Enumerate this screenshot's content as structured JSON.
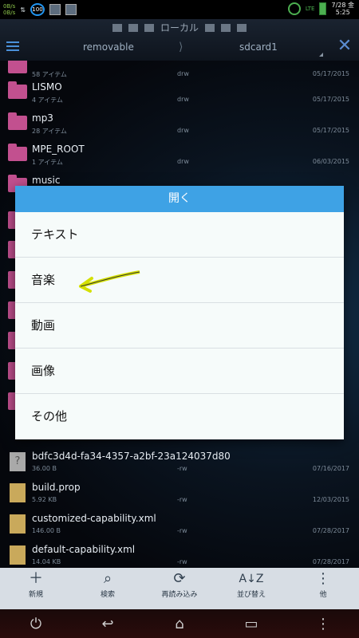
{
  "status_bar": {
    "net_up": "0B/s",
    "net_down": "0B/s",
    "badge": "100",
    "lte": "LTE",
    "date": "7/28 金",
    "time": "5:25"
  },
  "header": {
    "tab_label": "ローカル",
    "crumb_left": "removable",
    "crumb_separator": "⟩",
    "crumb_right": "sdcard1"
  },
  "files": [
    {
      "name": "",
      "meta": "58 アイテム",
      "perm": "drw",
      "date": "05/17/2015",
      "type": "folder"
    },
    {
      "name": "LISMO",
      "meta": "4 アイテム",
      "perm": "drw",
      "date": "05/17/2015",
      "type": "folder"
    },
    {
      "name": "mp3",
      "meta": "28 アイテム",
      "perm": "drw",
      "date": "05/17/2015",
      "type": "folder"
    },
    {
      "name": "MPE_ROOT",
      "meta": "1 アイテム",
      "perm": "drw",
      "date": "06/03/2015",
      "type": "folder"
    },
    {
      "name": "music",
      "meta": "",
      "perm": "",
      "date": "",
      "type": "folder"
    },
    {
      "name": "bdfc3d4d-fa34-4357-a2bf-23a124037d80",
      "meta": "36.00 B",
      "perm": "-rw",
      "date": "07/16/2017",
      "type": "unknown"
    },
    {
      "name": "build.prop",
      "meta": "5.92 KB",
      "perm": "-rw",
      "date": "12/03/2015",
      "type": "file"
    },
    {
      "name": "customized-capability.xml",
      "meta": "146.00 B",
      "perm": "-rw",
      "date": "07/28/2017",
      "type": "file"
    },
    {
      "name": "default-capability.xml",
      "meta": "14.04 KB",
      "perm": "-rw",
      "date": "07/28/2017",
      "type": "file"
    }
  ],
  "dialog": {
    "title": "開く",
    "items": [
      "テキスト",
      "音楽",
      "動画",
      "画像",
      "その他"
    ]
  },
  "toolbar": {
    "new": "新規",
    "search": "検索",
    "reload": "再読み込み",
    "sort": "並び替え",
    "other": "他"
  }
}
